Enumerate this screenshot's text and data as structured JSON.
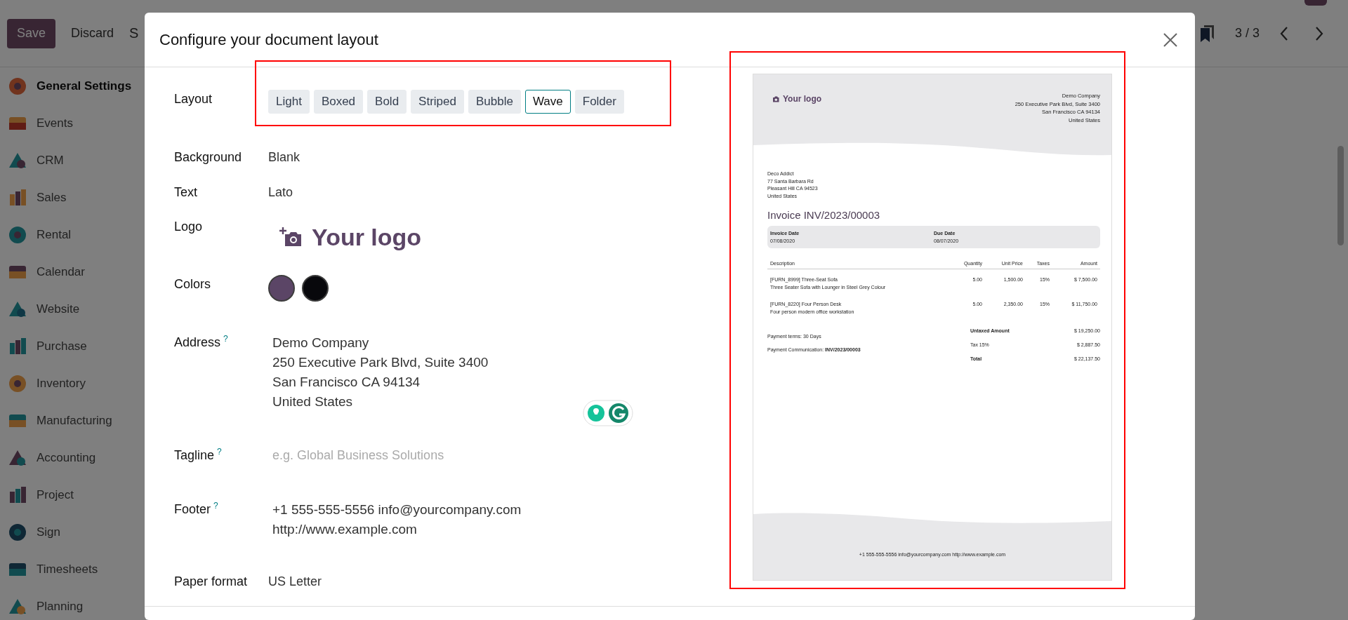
{
  "top_bar": {
    "buttons": [
      {
        "label": "Save",
        "kind": "primary"
      },
      {
        "label": "Discard",
        "kind": "secondary"
      }
    ],
    "breadcrumb": "S",
    "pager": "3 / 3"
  },
  "sidebar": {
    "items": [
      {
        "label": "General Settings",
        "selected": true
      },
      {
        "label": "Events",
        "selected": false
      },
      {
        "label": "CRM",
        "selected": false
      },
      {
        "label": "Sales",
        "selected": false
      },
      {
        "label": "Rental",
        "selected": false
      },
      {
        "label": "Calendar",
        "selected": false
      },
      {
        "label": "Website",
        "selected": false
      },
      {
        "label": "Purchase",
        "selected": false
      },
      {
        "label": "Inventory",
        "selected": false
      },
      {
        "label": "Manufacturing",
        "selected": false
      },
      {
        "label": "Accounting",
        "selected": false
      },
      {
        "label": "Project",
        "selected": false
      },
      {
        "label": "Sign",
        "selected": false
      },
      {
        "label": "Timesheets",
        "selected": false
      },
      {
        "label": "Planning",
        "selected": false
      }
    ]
  },
  "dialog": {
    "title": "Configure your document layout",
    "fields": [
      {
        "label": "Layout",
        "kind": "choices",
        "options": [
          {
            "label": "Light",
            "selected": false
          },
          {
            "label": "Boxed",
            "selected": false
          },
          {
            "label": "Bold",
            "selected": false
          },
          {
            "label": "Striped",
            "selected": false
          },
          {
            "label": "Bubble",
            "selected": false
          },
          {
            "label": "Wave",
            "selected": true
          },
          {
            "label": "Folder",
            "selected": false
          }
        ]
      },
      {
        "label": "Background",
        "kind": "text",
        "value": "Blank"
      },
      {
        "label": "Text",
        "kind": "text",
        "value": "Lato"
      },
      {
        "label": "Logo",
        "kind": "logo",
        "value": "Your logo"
      },
      {
        "label": "Colors",
        "kind": "colors",
        "colors": [
          {
            "color": "#5b4566"
          },
          {
            "color": "#08080c"
          }
        ]
      },
      {
        "label": "Address",
        "kind": "lines",
        "help": "?",
        "lines": [
          "Demo Company",
          "250 Executive Park Blvd, Suite 3400",
          "San Francisco CA 94134",
          "United States"
        ]
      },
      {
        "label": "Tagline",
        "kind": "field",
        "help": "?",
        "placeholder": "e.g. Global Business Solutions"
      },
      {
        "label": "Footer",
        "kind": "lines",
        "help": "?",
        "lines": [
          "+1 555-555-5556 info@yourcompany.com",
          "http://www.example.com"
        ]
      },
      {
        "label": "Paper format",
        "kind": "text",
        "value": "US Letter"
      }
    ]
  },
  "preview": {
    "logo": "Your logo",
    "company_lines": [
      "Demo Company",
      "250 Executive Park Blvd, Suite 3400",
      "San Francisco CA 94134",
      "United States"
    ],
    "customer_lines": [
      "Deco Addict",
      "77 Santa Barbara Rd",
      "Pleasant Hill CA 94523",
      "United States"
    ],
    "title": "Invoice INV/2023/00003",
    "dates": [
      {
        "label": "Invoice Date",
        "value": "07/08/2020"
      },
      {
        "label": "Due Date",
        "value": "08/07/2020"
      }
    ],
    "columns": [
      "Description",
      "Quantity",
      "Unit Price",
      "Taxes",
      "Amount"
    ],
    "rows": [
      {
        "cells": [
          "[FURN_8999] Three-Seat Sofa",
          "5.00",
          "1,500.00",
          "15%",
          "$ 7,500.00"
        ],
        "note": "Three Seater Sofa with Lounger in Steel Grey Colour"
      },
      {
        "cells": [
          "[FURN_8220] Four Person Desk",
          "5.00",
          "2,350.00",
          "15%",
          "$ 11,750.00"
        ],
        "note": "Four person modern office workstation"
      }
    ],
    "payment_terms": "Payment terms: 30 Days",
    "payment_communication": "Payment Communication: **INV/2023/00003**",
    "totals": [
      {
        "label": "Untaxed Amount",
        "value": "$ 19,250.00",
        "bold": true
      },
      {
        "label": "Tax 15%",
        "value": "$ 2,887.50",
        "bold": false
      },
      {
        "label": "Total",
        "value": "$ 22,137.50",
        "bold": true
      }
    ],
    "footer": "+1 555-555-5556 info@yourcompany.com http://www.example.com"
  }
}
